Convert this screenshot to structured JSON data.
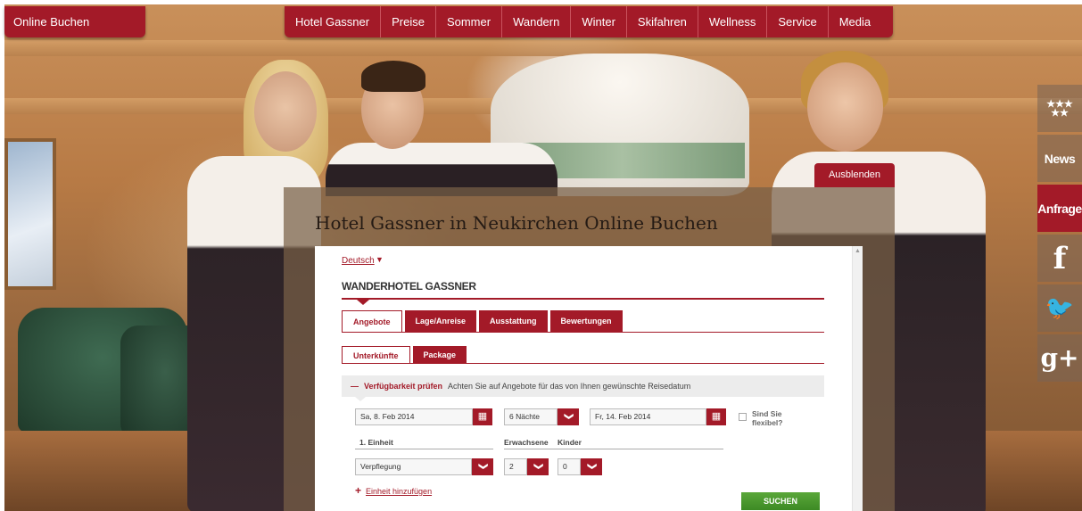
{
  "header": {
    "online_buchen": "Online Buchen",
    "nav": [
      "Hotel Gassner",
      "Preise",
      "Sommer",
      "Wandern",
      "Winter",
      "Skifahren",
      "Wellness",
      "Service",
      "Media"
    ]
  },
  "sidebar": {
    "stars": "★★★\n★★",
    "news": "News",
    "anfrage": "Anfrage",
    "facebook_icon": "f",
    "twitter_icon": "🐦",
    "googleplus_icon": "g+"
  },
  "overlay": {
    "hide_button": "Ausblenden",
    "title": "Hotel Gassner in Neukirchen Online Buchen"
  },
  "booking": {
    "language": "Deutsch",
    "hotel_name": "WANDERHOTEL GASSNER",
    "tabs": [
      "Angebote",
      "Lage/Anreise",
      "Ausstattung",
      "Bewertungen"
    ],
    "subtabs": [
      "Unterkünfte",
      "Package"
    ],
    "availability": {
      "label": "Verfügbarkeit prüfen",
      "hint": "Achten Sie auf Angebote für das von Ihnen gewünschte Reisedatum"
    },
    "arrival": "Sa, 8. Feb 2014",
    "nights": "6 Nächte",
    "departure": "Fr, 14. Feb 2014",
    "flexible_label": "Sind Sie flexibel?",
    "unit_label": "1. Einheit",
    "adults_label": "Erwachsene",
    "children_label": "Kinder",
    "board": "Verpflegung",
    "adults": "2",
    "children": "0",
    "add_unit": "Einheit hinzufügen",
    "search_button": "SUCHEN"
  },
  "colors": {
    "brand_red": "#a31a28",
    "search_green": "#4a9a2e"
  }
}
